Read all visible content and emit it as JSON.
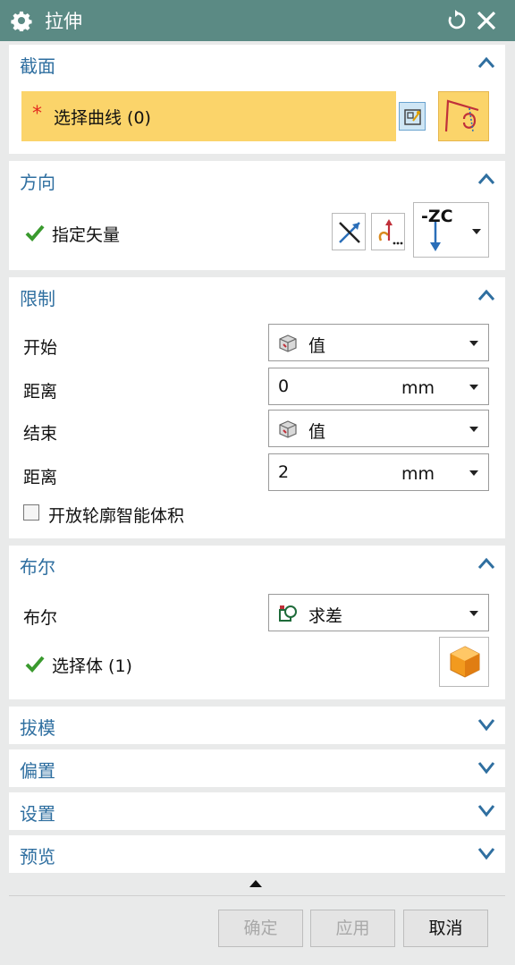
{
  "window": {
    "title": "拉伸",
    "icons": {
      "gear": "gear-icon",
      "reset": "reset-icon",
      "close": "close-icon"
    }
  },
  "sections": {
    "section": {
      "title": "截面",
      "select_curve": "选择曲线 (0)",
      "required_mark": "*"
    },
    "direction": {
      "title": "方向",
      "specify_vector": "指定矢量",
      "vector_value": "-ZC"
    },
    "limits": {
      "title": "限制",
      "start_label": "开始",
      "start_value": "值",
      "distance1_label": "距离",
      "distance1_value": "0",
      "distance1_unit": "mm",
      "end_label": "结束",
      "end_value": "值",
      "distance2_label": "距离",
      "distance2_value": "2",
      "distance2_unit": "mm",
      "open_profile": "开放轮廓智能体积"
    },
    "boolean": {
      "title": "布尔",
      "boolean_label": "布尔",
      "boolean_value": "求差",
      "select_body": "选择体 (1)"
    },
    "draft": {
      "title": "拔模"
    },
    "offset": {
      "title": "偏置"
    },
    "settings": {
      "title": "设置"
    },
    "preview": {
      "title": "预览"
    }
  },
  "buttons": {
    "ok": "确定",
    "apply": "应用",
    "cancel": "取消"
  },
  "colors": {
    "titlebar": "#5b8a84",
    "section_title": "#2f6fa0",
    "selection_highlight": "#fbd46a",
    "check_green": "#3a9a2e"
  }
}
